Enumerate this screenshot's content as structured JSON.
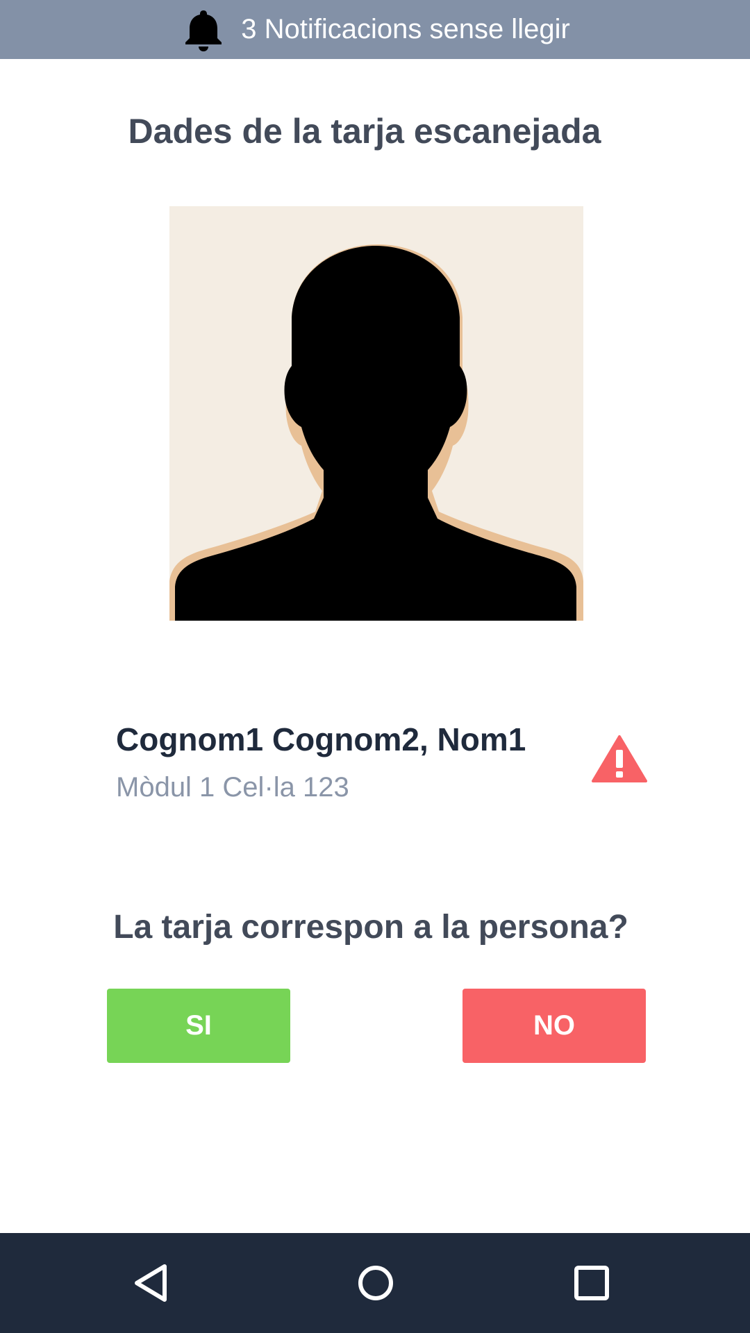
{
  "notification_bar": {
    "icon": "bell-icon",
    "text": "3 Notificacions sense llegir"
  },
  "page_title": "Dades de la tarja escanejada",
  "photo": {
    "type": "silhouette-avatar",
    "background_color": "#f4ede3"
  },
  "person": {
    "name": "Cognom1 Cognom2, Nom1",
    "location": "Mòdul 1 Cel·la 123",
    "status_icon": "warning-icon",
    "status_color": "#f86266"
  },
  "question": "La tarja correspon a la persona?",
  "buttons": {
    "yes_label": "SI",
    "no_label": "NO",
    "yes_color": "#77d456",
    "no_color": "#f86266"
  },
  "navigation": {
    "back_icon": "back-triangle-icon",
    "home_icon": "home-circle-icon",
    "recent_icon": "recent-apps-square-icon"
  },
  "colors": {
    "notification_bar": "#8391a7",
    "nav_bar": "#1f2a3c",
    "heading_text": "#424a59",
    "secondary_text": "#8a95a8"
  }
}
